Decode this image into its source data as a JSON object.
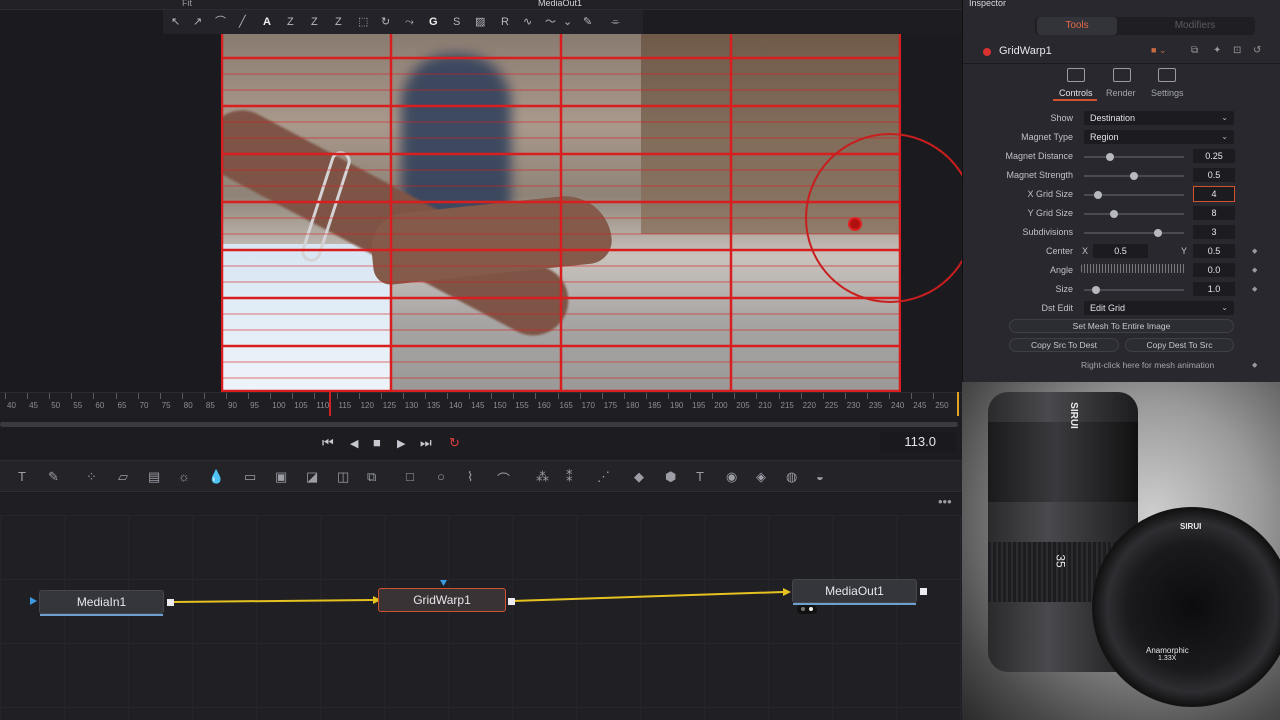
{
  "app": {
    "zoom_label": "Fit",
    "viewer_title": "MediaOut1"
  },
  "viewer_tools": [
    "A",
    "Z",
    "Z",
    "Z",
    "G",
    "S",
    "R"
  ],
  "ruler": {
    "ticks": [
      "40",
      "45",
      "50",
      "55",
      "60",
      "65",
      "70",
      "75",
      "80",
      "85",
      "90",
      "95",
      "100",
      "105",
      "110",
      "115",
      "120",
      "125",
      "130",
      "135",
      "140",
      "145",
      "150",
      "155",
      "160",
      "165",
      "170",
      "175",
      "180",
      "185",
      "190",
      "195",
      "200",
      "205",
      "210",
      "215",
      "220",
      "225",
      "230",
      "235",
      "240",
      "245",
      "250"
    ],
    "current_frame": "113.0"
  },
  "flow": {
    "nodes": [
      {
        "label": "MediaIn1"
      },
      {
        "label": "GridWarp1"
      },
      {
        "label": "MediaOut1"
      }
    ]
  },
  "inspector": {
    "title": "Inspector",
    "tab_tools": "Tools",
    "tab_modifiers": "Modifiers",
    "node_name": "GridWarp1",
    "control_tabs": [
      "Controls",
      "Render",
      "Settings"
    ],
    "rows": {
      "show_label": "Show",
      "show_value": "Destination",
      "magnet_type_label": "Magnet Type",
      "magnet_type_value": "Region",
      "magnet_distance_label": "Magnet Distance",
      "magnet_distance_value": "0.25",
      "magnet_strength_label": "Magnet Strength",
      "magnet_strength_value": "0.5",
      "x_grid_label": "X Grid Size",
      "x_grid_value": "4",
      "y_grid_label": "Y Grid Size",
      "y_grid_value": "8",
      "subdivisions_label": "Subdivisions",
      "subdivisions_value": "3",
      "center_label": "Center",
      "center_x_label": "X",
      "center_x_value": "0.5",
      "center_y_label": "Y",
      "center_y_value": "0.5",
      "angle_label": "Angle",
      "angle_value": "0.0",
      "size_label": "Size",
      "size_value": "1.0",
      "dst_edit_label": "Dst Edit",
      "dst_edit_value": "Edit Grid"
    },
    "buttons": {
      "set_mesh": "Set Mesh To Entire Image",
      "copy_src": "Copy Src To Dest",
      "copy_dest": "Copy Dest To Src"
    },
    "hint": "Right-click here for mesh animation"
  },
  "ad": {
    "brand": "SIRUI",
    "text_anamorphic": "Anamorphic",
    "text_ratio": "1.33X",
    "text_focal": "35"
  },
  "colors": {
    "grid_red": "#d81e1e",
    "accent_orange": "#d2512f",
    "wire_yellow": "#e6c220"
  }
}
